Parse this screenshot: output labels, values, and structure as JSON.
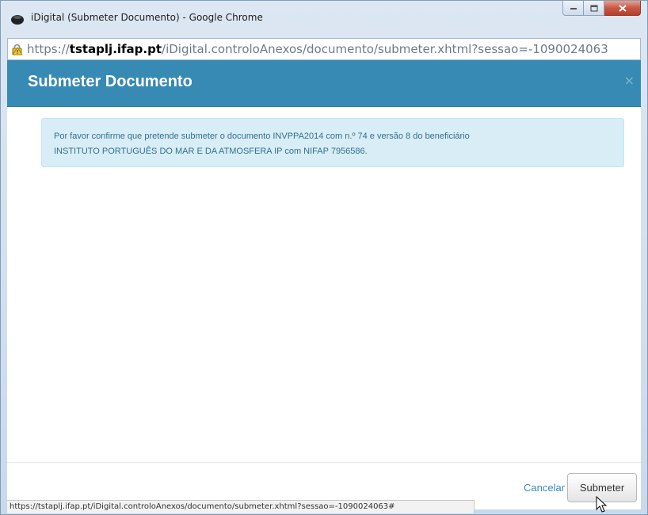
{
  "window": {
    "title": "iDigital (Submeter Documento) - Google Chrome",
    "icons": {
      "app": "chrome-globe-icon",
      "minimize": "minimize-icon",
      "maximize": "maximize-icon",
      "close": "close-icon"
    }
  },
  "addressbar": {
    "lock_icon": "warning-lock-icon",
    "scheme": "https://",
    "host": "tstaplj.ifap.pt",
    "path": "/iDigital.controloAnexos/documento/submeter.xhtml?sessao=-1090024063"
  },
  "modal": {
    "title": "Submeter Documento",
    "close_symbol": "×",
    "message_line1": "Por favor confirme que pretende submeter o documento INVPPA2014 com n.º 74 e versão 8 do beneficiário",
    "message_line2": "INSTITUTO PORTUGUÊS DO MAR E DA ATMOSFERA IP com NIFAP 7956586.",
    "cancel_label": "Cancelar",
    "submit_label": "Submeter"
  },
  "statusbar": {
    "text": "https://tstaplj.ifap.pt/iDigital.controloAnexos/documento/submeter.xhtml?sessao=-1090024063#"
  },
  "colors": {
    "header": "#378ab3",
    "alert_bg": "#d9edf7",
    "alert_text": "#31708f",
    "link": "#3a87c0"
  }
}
